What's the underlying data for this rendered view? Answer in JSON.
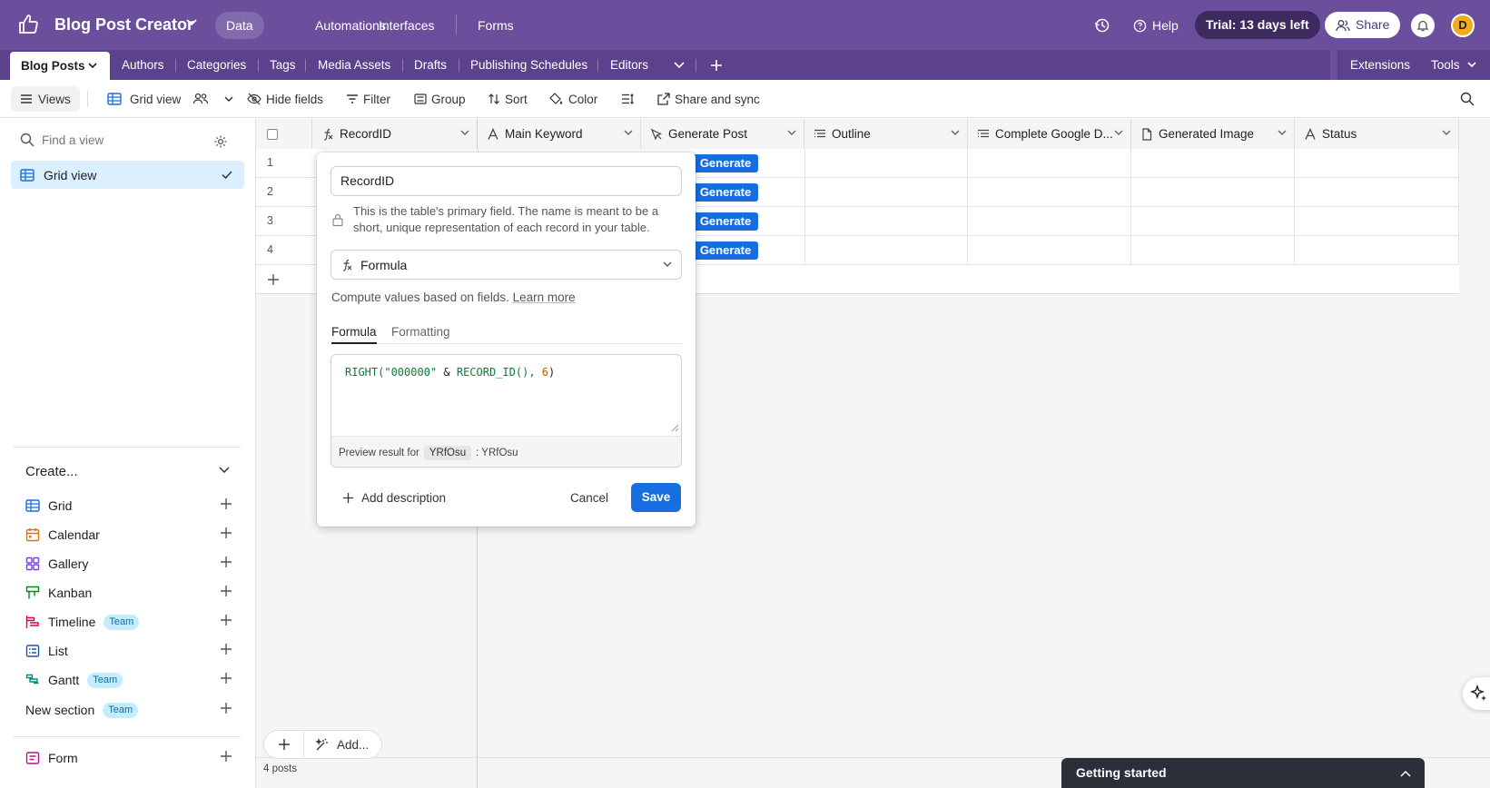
{
  "topbar": {
    "base_name": "Blog Post Creator",
    "nav": [
      "Data",
      "Automations",
      "Interfaces",
      "Forms"
    ],
    "help_label": "Help",
    "trial_label": "Trial: 13 days left",
    "share_label": "Share",
    "avatar_initial": "D"
  },
  "tables": {
    "active": "Blog Posts",
    "items": [
      "Authors",
      "Categories",
      "Tags",
      "Media Assets",
      "Drafts",
      "Publishing Schedules",
      "Editors"
    ],
    "extensions_label": "Extensions",
    "tools_label": "Tools"
  },
  "viewbar": {
    "views_label": "Views",
    "view_name": "Grid view",
    "hide_fields": "Hide fields",
    "filter": "Filter",
    "group": "Group",
    "sort": "Sort",
    "color": "Color",
    "share_sync": "Share and sync"
  },
  "sidebar": {
    "find_placeholder": "Find a view",
    "active_view": "Grid view",
    "create_label": "Create...",
    "create_items": [
      {
        "label": "Grid",
        "icon": "grid-icon",
        "color": "#166ee1"
      },
      {
        "label": "Calendar",
        "icon": "calendar-icon",
        "color": "#d9730d"
      },
      {
        "label": "Gallery",
        "icon": "gallery-icon",
        "color": "#7c39ed"
      },
      {
        "label": "Kanban",
        "icon": "kanban-icon",
        "color": "#048a0e"
      },
      {
        "label": "Timeline",
        "icon": "timeline-icon",
        "color": "#dc043b",
        "badge": "Team"
      },
      {
        "label": "List",
        "icon": "list-icon",
        "color": "#1a55b5"
      },
      {
        "label": "Gantt",
        "icon": "gantt-icon",
        "color": "#0f8a7a",
        "badge": "Team"
      }
    ],
    "new_section": "New section",
    "new_section_badge": "Team",
    "form_label": "Form"
  },
  "grid": {
    "columns": [
      "RecordID",
      "Main Keyword",
      "Generate Post",
      "Outline",
      "Complete Google D...",
      "Generated Image",
      "Status"
    ],
    "rows": [
      "1",
      "2",
      "3",
      "4"
    ],
    "button_label": "Generate",
    "add_label": "Add...",
    "record_count": "4 posts"
  },
  "popover": {
    "field_name": "RecordID",
    "primary_note": "This is the table's primary field. The name is meant to be a short, unique representation of each record in your table.",
    "field_type": "Formula",
    "description": "Compute values based on fields.",
    "learn_more": "Learn more",
    "tabs": [
      "Formula",
      "Formatting"
    ],
    "formula": {
      "fn1": "RIGHT(",
      "str": "\"000000\"",
      "amp": " & ",
      "fn2": "RECORD_ID(), ",
      "num": "6",
      "close": ")"
    },
    "preview_prefix": "Preview result for",
    "preview_record": "YRfOsu",
    "preview_result": ": YRfOsu",
    "add_description": "Add description",
    "cancel": "Cancel",
    "save": "Save"
  },
  "getting_started": "Getting started",
  "colors": {
    "topbar": "#6b4f9d",
    "accent_blue": "#166ee1",
    "selected_view_bg": "#dbeffe"
  }
}
